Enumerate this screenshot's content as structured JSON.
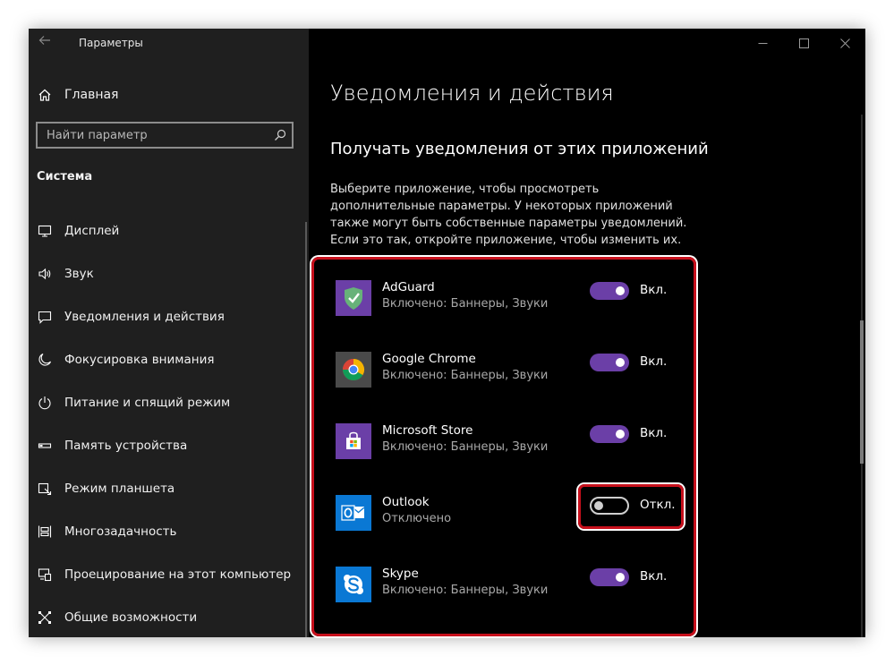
{
  "window": {
    "title": "Параметры"
  },
  "sidebar": {
    "home_label": "Главная",
    "search_placeholder": "Найти параметр",
    "section_title": "Система",
    "items": [
      {
        "label": "Дисплей",
        "icon": "display-icon"
      },
      {
        "label": "Звук",
        "icon": "speaker-icon"
      },
      {
        "label": "Уведомления и действия",
        "icon": "notification-icon"
      },
      {
        "label": "Фокусировка внимания",
        "icon": "moon-icon"
      },
      {
        "label": "Питание и спящий режим",
        "icon": "power-icon"
      },
      {
        "label": "Память устройства",
        "icon": "storage-icon"
      },
      {
        "label": "Режим планшета",
        "icon": "tablet-mode-icon"
      },
      {
        "label": "Многозадачность",
        "icon": "multitasking-icon"
      },
      {
        "label": "Проецирование на этот компьютер",
        "icon": "projection-icon"
      },
      {
        "label": "Общие возможности",
        "icon": "shared-experiences-icon"
      }
    ]
  },
  "main": {
    "page_title": "Уведомления и действия",
    "section_title": "Получать уведомления от этих приложений",
    "description": "Выберите приложение, чтобы просмотреть дополнительные параметры. У некоторых приложений также могут быть собственные параметры уведомлений. Если это так, откройте приложение, чтобы изменить их.",
    "apps": [
      {
        "name": "AdGuard",
        "status": "Включено: Баннеры, Звуки",
        "toggle_on": true,
        "toggle_label": "Вкл.",
        "icon": "adguard-icon",
        "icon_color": "#6b3fa7"
      },
      {
        "name": "Google Chrome",
        "status": "Включено: Баннеры, Звуки",
        "toggle_on": true,
        "toggle_label": "Вкл.",
        "icon": "chrome-icon",
        "icon_color": "#4a4a4a"
      },
      {
        "name": "Microsoft Store",
        "status": "Включено: Баннеры, Звуки",
        "toggle_on": true,
        "toggle_label": "Вкл.",
        "icon": "store-icon",
        "icon_color": "#6b3fa7"
      },
      {
        "name": "Outlook",
        "status": "Отключено",
        "toggle_on": false,
        "toggle_label": "Откл.",
        "icon": "outlook-icon",
        "icon_color": "#0a78d4"
      },
      {
        "name": "Skype",
        "status": "Включено: Баннеры, Звуки",
        "toggle_on": true,
        "toggle_label": "Вкл.",
        "icon": "skype-icon",
        "icon_color": "#0a78d4"
      }
    ]
  },
  "colors": {
    "accent": "#6b3fa7",
    "highlight": "#c7101c"
  }
}
